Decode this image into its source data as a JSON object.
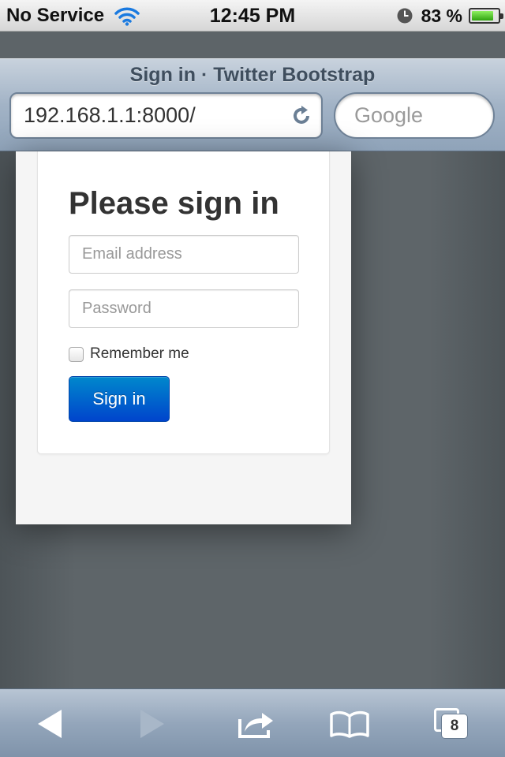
{
  "status_bar": {
    "carrier": "No Service",
    "time": "12:45 PM",
    "battery_percent": "83 %",
    "battery_level": 0.83
  },
  "browser": {
    "page_title": "Sign in · Twitter Bootstrap",
    "url": "192.168.1.1:8000/",
    "search_placeholder": "Google"
  },
  "form": {
    "heading": "Please sign in",
    "email_placeholder": "Email address",
    "password_placeholder": "Password",
    "remember_label": "Remember me",
    "submit_label": "Sign in"
  },
  "toolbar": {
    "tab_count": "8"
  },
  "colors": {
    "primary_button": "#0055cc",
    "battery_green": "#2fa310",
    "wifi_blue": "#1a7ae0"
  }
}
